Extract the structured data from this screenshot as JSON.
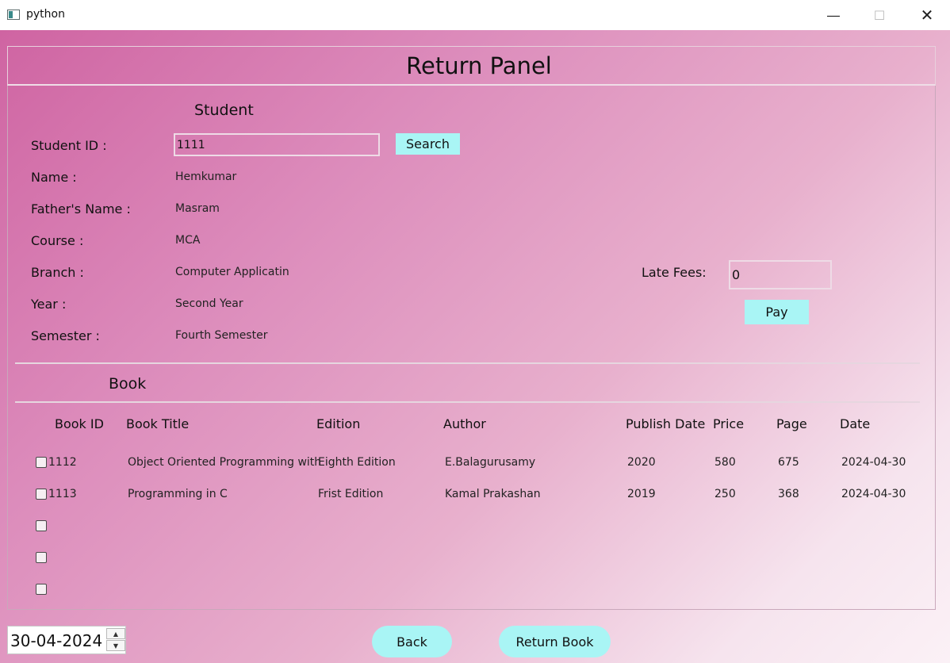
{
  "window": {
    "title": "python"
  },
  "panel": {
    "title": "Return Panel"
  },
  "student": {
    "section_title": "Student",
    "id_label": "Student ID :",
    "id_value": "1111",
    "search_label": "Search",
    "fields": [
      {
        "label": "Name :",
        "value": "Hemkumar"
      },
      {
        "label": "Father's Name :",
        "value": "Masram"
      },
      {
        "label": "Course :",
        "value": "MCA"
      },
      {
        "label": "Branch :",
        "value": "Computer Applicatin"
      },
      {
        "label": "Year :",
        "value": "Second Year"
      },
      {
        "label": "Semester :",
        "value": "Fourth Semester"
      }
    ]
  },
  "fees": {
    "label": "Late Fees:",
    "value": "0",
    "pay_label": "Pay"
  },
  "book": {
    "section_title": "Book",
    "columns": [
      "Book ID",
      "Book Title",
      "Edition",
      "Author",
      "Publish Date",
      "Price",
      "Page",
      "Date"
    ],
    "rows": [
      {
        "id": "1112",
        "title": "Object Oriented Programming with",
        "edition": "Eighth Edition",
        "author": "E.Balagurusamy",
        "publish": "2020",
        "price": "580",
        "page": "675",
        "date": "2024-04-30"
      },
      {
        "id": "1113",
        "title": "Programming in C",
        "edition": "Frist Edition",
        "author": "Kamal Prakashan",
        "publish": "2019",
        "price": "250",
        "page": "368",
        "date": "2024-04-30"
      }
    ]
  },
  "footer": {
    "date_value": "30-04-2024",
    "back_label": "Back",
    "return_label": "Return Book"
  }
}
